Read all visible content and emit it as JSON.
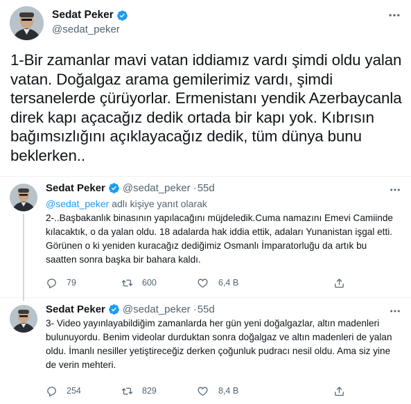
{
  "main_tweet": {
    "name": "Sedat Peker",
    "handle": "@sedat_peker",
    "text": "1-Bir zamanlar mavi vatan iddiamız vardı şimdi oldu yalan vatan. Doğalgaz arama gemilerimiz vardı, şimdi tersanelerde çürüyorlar. Ermenistanı yendik Azerbaycanla direk kapı açacağız dedik ortada bir kapı yok. Kıbrısın bağımsızlığını açıklayacağız dedik, tüm dünya bunu beklerken.."
  },
  "replies": [
    {
      "name": "Sedat Peker",
      "handle": "@sedat_peker",
      "separator": "·",
      "time": "55d",
      "replying_handle": "@sedat_peker",
      "replying_suffix": " adlı kişiye yanıt olarak",
      "text": "2-..Başbakanlık binasının yapılacağını müjdeledik.Cuma namazını Emevi Camiinde kılacaktık, o da yalan oldu. 18 adalarda hak iddia ettik, adaları Yunanistan işgal etti. Görünen o ki yeniden kuracağız dediğimiz Osmanlı İmparatorluğu da artık bu saatten sonra başka bir bahara kaldı.",
      "counts": {
        "reply": "79",
        "retweet": "600",
        "like": "6,4 B"
      }
    },
    {
      "name": "Sedat Peker",
      "handle": "@sedat_peker",
      "separator": "·",
      "time": "55d",
      "text": "3- Video yayınlayabildiğim zamanlarda her gün yeni doğalgazlar, altın madenleri bulunuyordu. Benim videolar durduktan sonra doğalgaz ve altın madenleri de yalan oldu. İmanlı nesiller yetiştireceğiz derken çoğunluk pudracı nesil oldu. Ama siz yine de verin mehteri.",
      "counts": {
        "reply": "254",
        "retweet": "829",
        "like": "8,4 B"
      }
    }
  ],
  "icons": {
    "verified": "verified-badge-icon",
    "more": "more-options-icon",
    "reply": "reply-icon",
    "retweet": "retweet-icon",
    "like": "heart-icon",
    "share": "share-icon"
  },
  "colors": {
    "accent": "#1d9bf0",
    "text": "#0f1419",
    "muted": "#536471"
  }
}
